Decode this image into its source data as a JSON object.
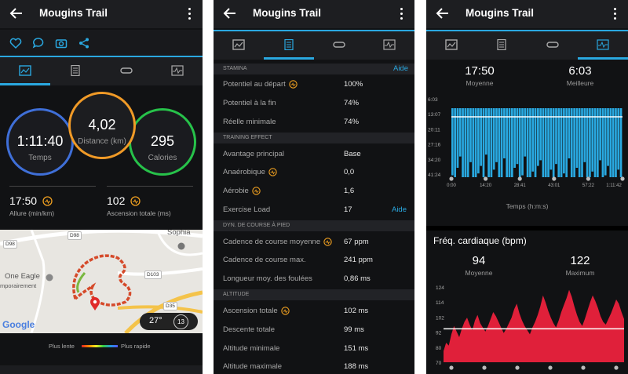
{
  "title": "Mougins Trail",
  "tabs": [
    "summary-tab",
    "details-tab",
    "laps-tab",
    "charts-tab"
  ],
  "panel1": {
    "circles": [
      {
        "value": "1:11:40",
        "label": "Temps"
      },
      {
        "value": "4,02",
        "label": "Distance (km)"
      },
      {
        "value": "295",
        "label": "Calories"
      }
    ],
    "stats": [
      {
        "value": "17:50",
        "label": "Allure (min/km)"
      },
      {
        "value": "102",
        "label": "Ascension totale (ms)"
      }
    ],
    "map": {
      "labels": {
        "d98a": "D98",
        "d98b": "D98",
        "d103": "D103",
        "d35": "D35",
        "sophia": "Sophia",
        "eagle1": "One Eagle",
        "eagle2": "mporairement",
        "google": "Google"
      },
      "temp": "27°",
      "wind": "13"
    },
    "legend": {
      "slow": "Plus lente",
      "fast": "Plus rapide"
    }
  },
  "panel2": {
    "sections": {
      "stamina": "STAMINA",
      "training": "TRAINING EFFECT",
      "dyn": "DYN. DE COURSE À PIED",
      "altitude": "ALTITUDE"
    },
    "help": "Aide",
    "rows": {
      "r1": {
        "k": "Potentiel au départ",
        "v": "100%"
      },
      "r2": {
        "k": "Potentiel à la fin",
        "v": "74%"
      },
      "r3": {
        "k": "Réelle minimale",
        "v": "74%"
      },
      "r4": {
        "k": "Avantage principal",
        "v": "Base"
      },
      "r5": {
        "k": "Anaérobique",
        "v": "0,0"
      },
      "r6": {
        "k": "Aérobie",
        "v": "1,6"
      },
      "r7": {
        "k": "Exercise Load",
        "v": "17"
      },
      "r8": {
        "k": "Cadence de course moyenne",
        "v": "67 ppm"
      },
      "r9": {
        "k": "Cadence de course max.",
        "v": "241 ppm"
      },
      "r10": {
        "k": "Longueur moy. des foulées",
        "v": "0,86 ms"
      },
      "r11": {
        "k": "Ascension totale",
        "v": "102 ms"
      },
      "r12": {
        "k": "Descente totale",
        "v": "99 ms"
      },
      "r13": {
        "k": "Altitude minimale",
        "v": "151 ms"
      },
      "r14": {
        "k": "Altitude maximale",
        "v": "188 ms"
      }
    }
  },
  "panel3": {
    "pace": {
      "avg": "17:50",
      "avg_label": "Moyenne",
      "best": "6:03",
      "best_label": "Meilleure"
    },
    "hr_title": "Fréq. cardiaque (bpm)",
    "hr": {
      "avg": "94",
      "avg_label": "Moyenne",
      "max": "122",
      "max_label": "Maximum"
    },
    "pace_color": "#29a9e1",
    "hr_color": "#e0203a"
  },
  "chart_data": [
    {
      "type": "bar",
      "title": "",
      "xlabel": "Temps (h:m:s)",
      "ylabel": "",
      "y_ticks": [
        "6:03",
        "13:07",
        "20:11",
        "27:16",
        "34:20",
        "41:24"
      ],
      "x_ticks": [
        "0:00",
        "14:20",
        "28:41",
        "43:01",
        "57:22",
        "1:11:42"
      ],
      "average_line": "17:50",
      "series": [
        {
          "values": [
            19,
            22,
            15,
            9,
            30,
            28,
            35,
            12,
            25,
            20,
            18,
            14,
            33,
            8,
            26,
            31,
            16,
            12,
            29,
            24,
            10,
            34,
            21,
            27,
            15,
            13,
            32,
            19,
            9,
            23,
            28,
            17,
            36,
            14,
            11,
            25,
            30,
            20,
            16,
            24,
            13,
            27,
            33,
            18,
            22,
            10,
            29,
            26,
            15,
            31,
            21,
            12,
            34,
            25,
            17,
            23,
            30,
            11,
            28,
            19,
            14,
            26,
            32,
            20,
            16,
            24
          ]
        }
      ]
    },
    {
      "type": "area",
      "title": "Fréq. cardiaque (bpm)",
      "xlabel": "",
      "ylabel": "",
      "y_ticks": [
        "124",
        "114",
        "102",
        "92",
        "80",
        "70"
      ],
      "ylim": [
        70,
        124
      ],
      "average_line": 94,
      "series": [
        {
          "values": [
            78,
            84,
            82,
            90,
            96,
            92,
            88,
            94,
            99,
            102,
            97,
            93,
            100,
            104,
            98,
            95,
            92,
            96,
            101,
            106,
            103,
            99,
            95,
            91,
            94,
            98,
            102,
            108,
            112,
            105,
            100,
            96,
            93,
            90,
            95,
            99,
            104,
            110,
            118,
            113,
            107,
            102,
            98,
            95,
            100,
            106,
            111,
            116,
            122,
            117,
            110,
            104,
            99,
            96,
            101,
            107,
            113,
            118,
            114,
            109,
            103,
            99,
            97,
            101,
            105,
            110,
            115,
            112,
            106,
            101
          ]
        }
      ]
    }
  ]
}
